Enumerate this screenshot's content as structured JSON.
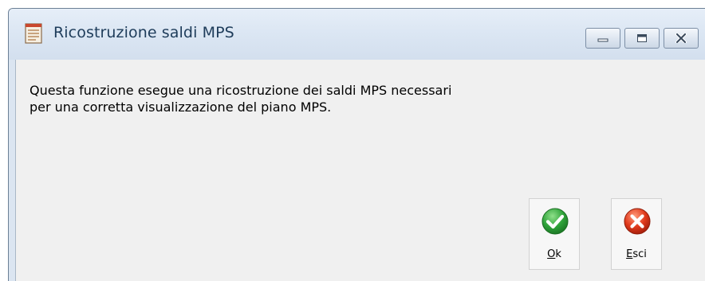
{
  "window": {
    "title": "Ricostruzione saldi MPS",
    "icon": "document-list-icon",
    "caption_buttons": [
      "minimize-icon",
      "maximize-icon",
      "close-icon"
    ]
  },
  "message": {
    "line1": "Questa funzione esegue una ricostruzione dei saldi MPS necessari",
    "line2": "per una corretta visualizzazione del piano MPS."
  },
  "buttons": {
    "ok": {
      "accel": "O",
      "rest": "k",
      "icon": "green-check-icon",
      "color": "#2fa33a"
    },
    "esci": {
      "accel": "E",
      "rest": "sci",
      "icon": "red-x-icon",
      "color": "#e03a1c"
    }
  }
}
